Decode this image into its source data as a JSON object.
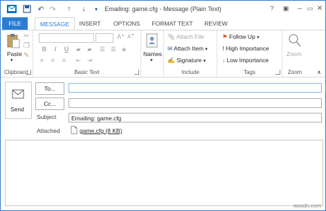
{
  "window": {
    "title": "Emailing: game.cfg - Message (Plain Text)",
    "help_label": "?",
    "controls": {
      "minimize": "–",
      "restore": "▭",
      "close": "✕",
      "ribbon_display": "▣"
    }
  },
  "tabs": [
    {
      "label": "FILE"
    },
    {
      "label": "MESSAGE"
    },
    {
      "label": "INSERT"
    },
    {
      "label": "OPTIONS"
    },
    {
      "label": "FORMAT TEXT"
    },
    {
      "label": "REVIEW"
    }
  ],
  "ribbon": {
    "clipboard": {
      "paste_label": "Paste",
      "group_label": "Clipboard"
    },
    "basic_text": {
      "group_label": "Basic Text",
      "bold": "B",
      "italic": "I",
      "underline": "U"
    },
    "names": {
      "label": "Names"
    },
    "include": {
      "attach_file": "Attach File",
      "attach_item": "Attach Item",
      "signature": "Signature",
      "group_label": "Include"
    },
    "tags": {
      "follow_up": "Follow Up",
      "high_importance": "High Importance",
      "low_importance": "Low Importance",
      "group_label": "Tags"
    },
    "zoom": {
      "label": "Zoom",
      "group_label": "Zoom"
    }
  },
  "compose": {
    "send_label": "Send",
    "to_label": "To...",
    "cc_label": "Cc...",
    "subject_label": "Subject",
    "subject_value": "Emailing: game.cfg",
    "attached_label": "Attached",
    "attachment": "game.cfg (8 KB)"
  },
  "watermark": "wsxdn.com"
}
